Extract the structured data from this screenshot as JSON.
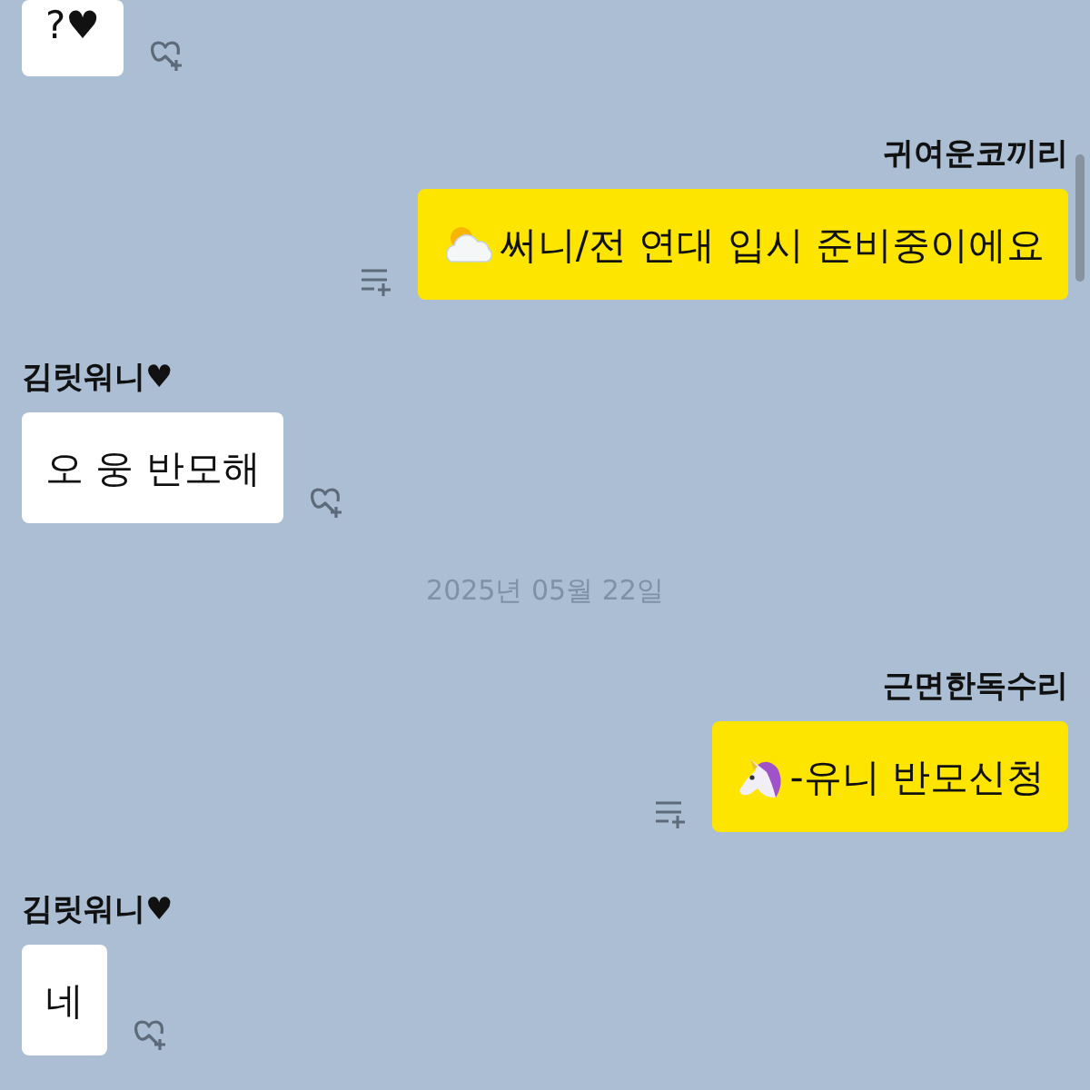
{
  "messages": [
    {
      "kind": "received",
      "text": "?♥"
    },
    {
      "kind": "sent",
      "sender": "귀여운코끼리",
      "text": "써니/전 연대 입시 준비중이에요"
    },
    {
      "kind": "received",
      "sender": "김릿워니♥",
      "text": "오 웅 반모해"
    },
    {
      "kind": "date",
      "text": "2025년 05월 22일"
    },
    {
      "kind": "sent",
      "sender": "근면한독수리",
      "text": "-유니 반모신청"
    },
    {
      "kind": "received",
      "sender": "김릿워니♥",
      "text": "네"
    }
  ]
}
